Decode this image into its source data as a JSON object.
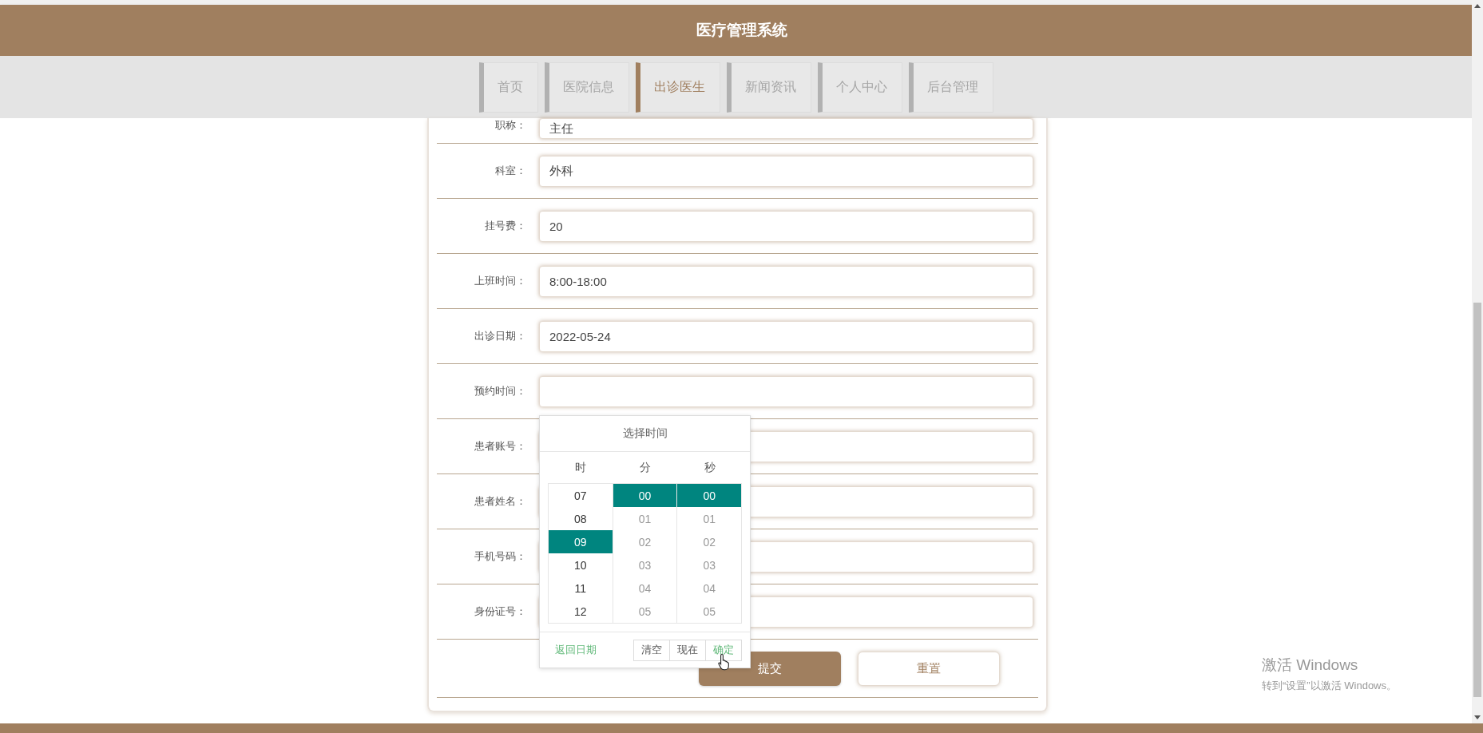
{
  "header": {
    "title": "医疗管理系统"
  },
  "nav": [
    {
      "label": "首页",
      "selected": false
    },
    {
      "label": "医院信息",
      "selected": false
    },
    {
      "label": "出诊医生",
      "selected": true
    },
    {
      "label": "新闻资讯",
      "selected": false
    },
    {
      "label": "个人中心",
      "selected": false
    },
    {
      "label": "后台管理",
      "selected": false
    }
  ],
  "form": {
    "fields": [
      {
        "label": "职称：",
        "value": "主任"
      },
      {
        "label": "科室：",
        "value": "外科"
      },
      {
        "label": "挂号费：",
        "value": "20"
      },
      {
        "label": "上班时间：",
        "value": "8:00-18:00"
      },
      {
        "label": "出诊日期：",
        "value": "2022-05-24"
      },
      {
        "label": "预约时间："
      },
      {
        "label": "患者账号："
      },
      {
        "label": "患者姓名："
      },
      {
        "label": "手机号码："
      },
      {
        "label": "身份证号："
      }
    ],
    "actions": [
      {
        "label": "提交",
        "kind": "primary"
      },
      {
        "label": "重置",
        "kind": "secondary"
      }
    ]
  },
  "time_picker": {
    "title": "选择时间",
    "columns": [
      {
        "label": "时",
        "items": [
          {
            "text": "07",
            "selected": false
          },
          {
            "text": "08",
            "selected": false
          },
          {
            "text": "09",
            "selected": true
          },
          {
            "text": "10",
            "selected": false
          },
          {
            "text": "11",
            "selected": false
          },
          {
            "text": "12",
            "selected": false
          }
        ]
      },
      {
        "label": "分",
        "items": [
          {
            "text": "00",
            "selected": true
          },
          {
            "text": "01",
            "selected": false
          },
          {
            "text": "02",
            "selected": false
          },
          {
            "text": "03",
            "selected": false
          },
          {
            "text": "04",
            "selected": false
          },
          {
            "text": "05",
            "selected": false
          }
        ]
      },
      {
        "label": "秒",
        "items": [
          {
            "text": "00",
            "selected": true
          },
          {
            "text": "01",
            "selected": false
          },
          {
            "text": "02",
            "selected": false
          },
          {
            "text": "03",
            "selected": false
          },
          {
            "text": "04",
            "selected": false
          },
          {
            "text": "05",
            "selected": false
          }
        ]
      }
    ],
    "back_link": "返回日期",
    "buttons": [
      "清空",
      "现在",
      "确定"
    ]
  },
  "os_notice": {
    "title": "激活 Windows",
    "text": "转到“设置”以激活 Windows。"
  }
}
